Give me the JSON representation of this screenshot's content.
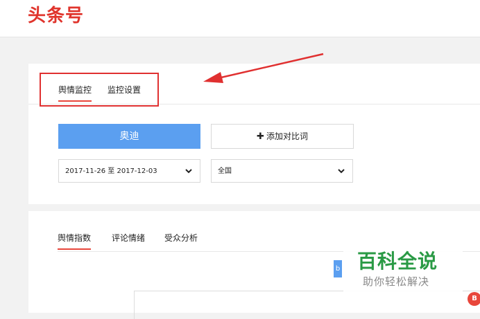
{
  "header": {
    "logo": "头条号"
  },
  "monitor": {
    "tabs": [
      {
        "label": "舆情监控",
        "active": true
      },
      {
        "label": "监控设置",
        "active": false
      }
    ],
    "keyword_button": "奥迪",
    "add_compare_label": "添加对比词",
    "date_range": "2017-11-26 至 2017-12-03",
    "region": "全国"
  },
  "analysis": {
    "tabs": [
      {
        "label": "舆情指数",
        "active": true
      },
      {
        "label": "评论情绪",
        "active": false
      },
      {
        "label": "受众分析",
        "active": false
      }
    ],
    "chart_button": "b",
    "marker_label": "B"
  },
  "watermark": {
    "title": "百科全说",
    "subtitle": "助你轻松解决"
  },
  "colors": {
    "brand": "#e0342c",
    "primary_button": "#5b9ff0",
    "active_tab_underline": "#e8463b",
    "annotation": "#e03030",
    "watermark_green": "#2a9a45"
  }
}
